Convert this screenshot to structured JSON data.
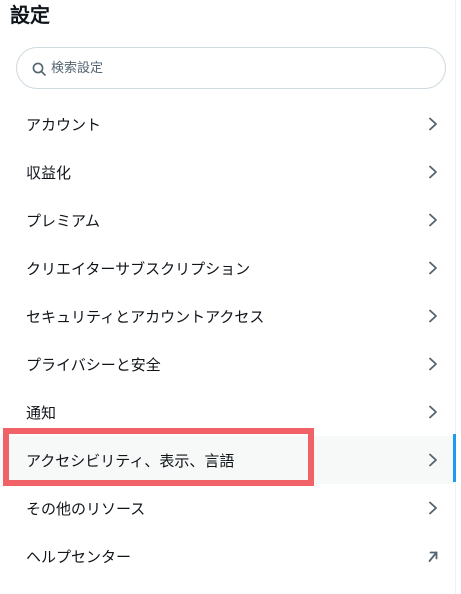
{
  "header": {
    "title": "設定"
  },
  "search": {
    "placeholder": "検索設定",
    "value": ""
  },
  "menu": {
    "items": [
      {
        "label": "アカウント",
        "icon": "chevron-right-icon"
      },
      {
        "label": "収益化",
        "icon": "chevron-right-icon"
      },
      {
        "label": "プレミアム",
        "icon": "chevron-right-icon"
      },
      {
        "label": "クリエイターサブスクリプション",
        "icon": "chevron-right-icon"
      },
      {
        "label": "セキュリティとアカウントアクセス",
        "icon": "chevron-right-icon"
      },
      {
        "label": "プライバシーと安全",
        "icon": "chevron-right-icon"
      },
      {
        "label": "通知",
        "icon": "chevron-right-icon"
      },
      {
        "label": "アクセシビリティ、表示、言語",
        "icon": "chevron-right-icon",
        "selected": true
      },
      {
        "label": "その他のリソース",
        "icon": "chevron-right-icon"
      },
      {
        "label": "ヘルプセンター",
        "icon": "external-arrow-icon"
      }
    ]
  },
  "colors": {
    "text": "#0f1419",
    "muted": "#536471",
    "border": "#cfd9de",
    "accent": "#1d9bf0",
    "highlight": "#f06268",
    "selected_bg": "#f7f9f9"
  }
}
